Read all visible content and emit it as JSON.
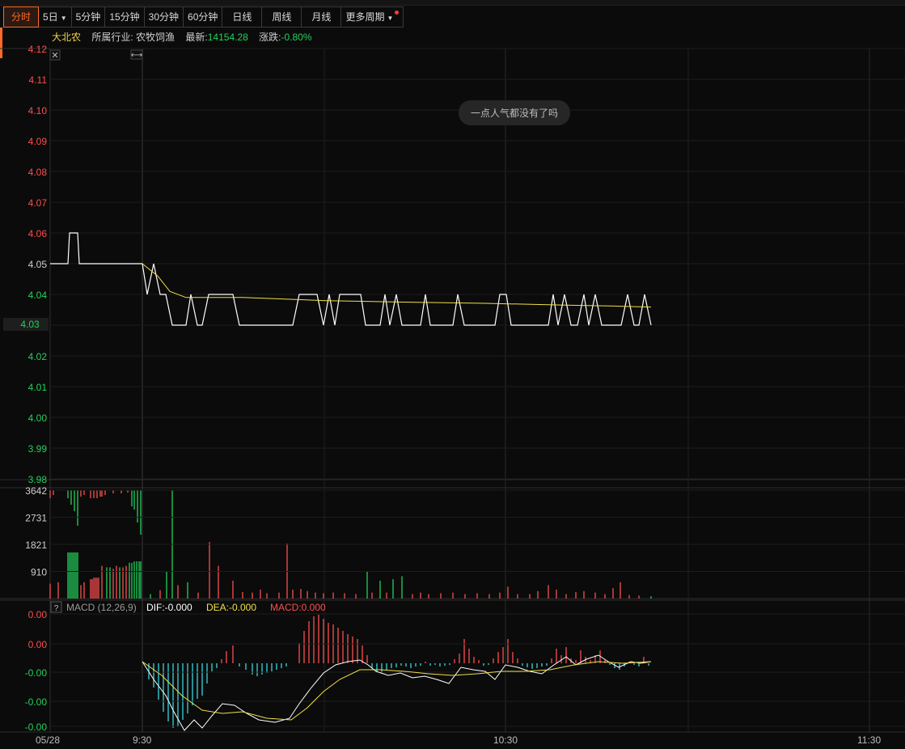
{
  "tabs": [
    {
      "label": "分时",
      "active": true
    },
    {
      "label": "5日",
      "caret": true
    },
    {
      "label": "5分钟"
    },
    {
      "label": "15分钟"
    },
    {
      "label": "30分钟"
    },
    {
      "label": "60分钟"
    },
    {
      "label": "日线"
    },
    {
      "label": "周线"
    },
    {
      "label": "月线"
    },
    {
      "label": "更多周期",
      "caret": true,
      "dot": true
    }
  ],
  "info": {
    "name": "大北农",
    "industry_label": "所属行业:",
    "industry": "农牧饲渔",
    "latest_label": "最新:",
    "latest": "14154.28",
    "change_label": "涨跌:",
    "change": "-0.80%"
  },
  "tooltip": "一点人气都没有了吗",
  "colors": {
    "up": "#ff4d4d",
    "down": "#22d15c",
    "avg": "#f0e04a",
    "price": "#ffffff",
    "cyan": "#36d7e0"
  },
  "price_axis": {
    "labels": [
      "4.12",
      "4.11",
      "4.10",
      "4.09",
      "4.08",
      "4.07",
      "4.06",
      "4.05",
      "4.04",
      "4.03",
      "4.02",
      "4.01",
      "4.00",
      "3.99",
      "3.98"
    ],
    "prev_close": "4.05",
    "current": "4.03"
  },
  "volume_axis": {
    "labels": [
      "3642",
      "2731",
      "1821",
      "910"
    ]
  },
  "macd": {
    "title": "MACD (12,26,9)",
    "dif": "DIF:-0.000",
    "dea": "DEA:-0.000",
    "macd": "MACD:0.000",
    "axis": [
      "0.00",
      "0.00",
      "-0.00",
      "-0.00",
      "-0.00"
    ]
  },
  "time_axis": {
    "date": "05/28",
    "t1": "9:30",
    "t2": "10:30",
    "t3": "11:30"
  },
  "chart_data": {
    "type": "line",
    "series": [
      {
        "name": "price",
        "values": [
          4.05,
          4.05,
          4.06,
          4.05,
          4.05,
          4.05,
          4.05,
          4.05,
          4.05,
          4.05,
          4.04,
          4.05,
          4.04,
          4.04,
          4.03,
          4.03,
          4.03,
          4.04,
          4.03,
          4.04,
          4.04,
          4.04,
          4.03,
          4.03,
          4.03,
          4.03,
          4.03,
          4.03,
          4.04,
          4.04,
          4.03,
          4.04,
          4.03,
          4.04,
          4.04,
          4.03,
          4.03,
          4.04,
          4.03,
          4.04,
          4.03,
          4.03,
          4.03,
          4.03,
          4.04,
          4.03,
          4.03,
          4.03,
          4.03,
          4.04,
          4.03,
          4.03,
          4.03,
          4.04,
          4.03,
          4.04,
          4.03,
          4.04,
          4.03,
          4.03,
          4.04,
          4.03,
          4.04
        ]
      },
      {
        "name": "avg",
        "values": [
          4.05,
          4.048,
          4.044,
          4.041,
          4.039,
          4.039,
          4.038,
          4.038,
          4.038,
          4.038,
          4.037,
          4.037,
          4.037,
          4.037,
          4.037,
          4.037,
          4.036,
          4.036,
          4.036,
          4.036,
          4.036,
          4.036
        ]
      }
    ],
    "ylim": [
      3.98,
      4.12
    ]
  }
}
